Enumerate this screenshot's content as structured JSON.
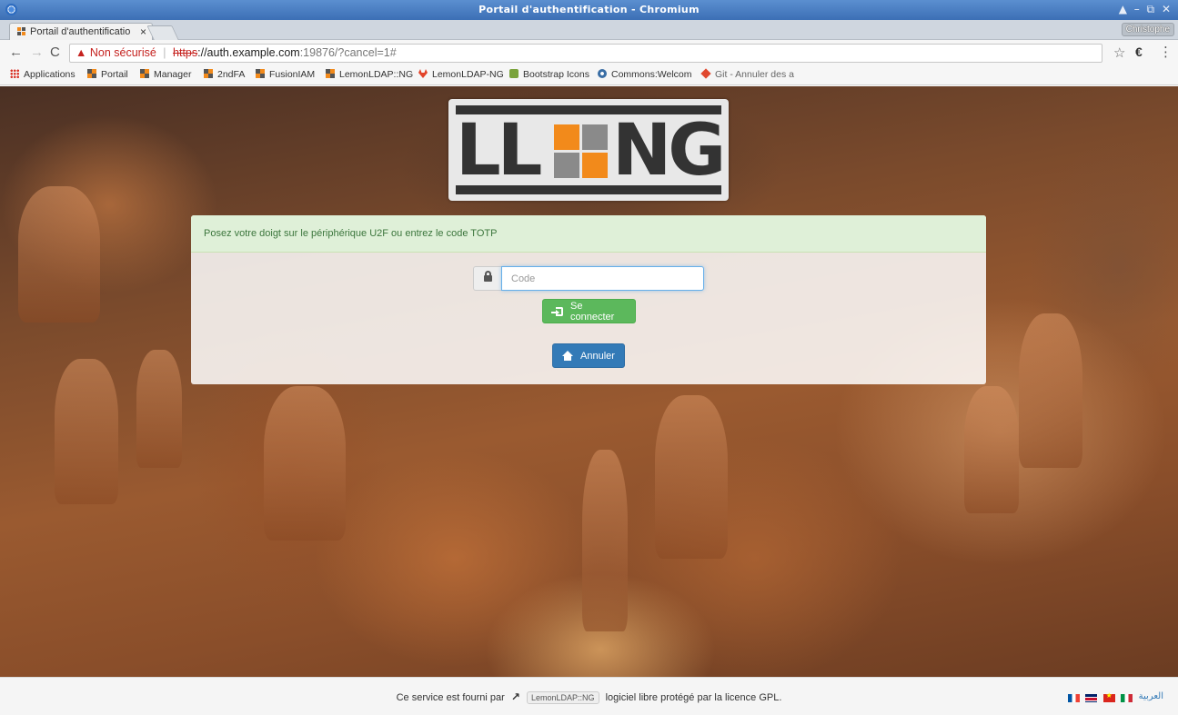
{
  "window": {
    "title": "Portail d'authentification - Chromium",
    "controls": "▲ – ⧉ ✕"
  },
  "tabs": [
    {
      "label": "Portail d'authentificatio",
      "close": "×"
    }
  ],
  "profile": {
    "name": "Christophe"
  },
  "omnibox": {
    "warning_label": "Non sécurisé",
    "scheme": "https",
    "host": "://auth.example.com",
    "rest": ":19876/?cancel=1#"
  },
  "bookmarks": [
    {
      "label": "Applications",
      "icon": "apps-grid-icon"
    },
    {
      "label": "Portail",
      "icon": "lemonldap-icon"
    },
    {
      "label": "Manager",
      "icon": "lemonldap-icon"
    },
    {
      "label": "2ndFA",
      "icon": "lemonldap-icon"
    },
    {
      "label": "FusionIAM",
      "icon": "lemonldap-icon"
    },
    {
      "label": "LemonLDAP::NG",
      "icon": "lemonldap-icon"
    },
    {
      "label": "LemonLDAP-NG",
      "icon": "gitlab-icon"
    },
    {
      "label": "Bootstrap Icons",
      "icon": "bootstrap-icon"
    },
    {
      "label": "Commons:Welcom",
      "icon": "wikimedia-icon"
    },
    {
      "label": "Git - Annuler des a",
      "icon": "git-icon"
    }
  ],
  "logo": {
    "text_left": "LL",
    "text_right": "NG",
    "colors": {
      "dark": "#333333",
      "orange": "#f28a1b",
      "light": "#e8e8e8",
      "mid": "#8a8a8a"
    }
  },
  "auth": {
    "message": "Posez votre doigt sur le périphérique U2F ou entrez le code TOTP",
    "code_placeholder": "Code",
    "login_button": "Se connecter",
    "cancel_button": "Annuler"
  },
  "footer": {
    "text_before": "Ce service est fourni par",
    "product": "LemonLDAP::NG",
    "text_after": "logiciel libre protégé par la licence GPL.",
    "languages": [
      "fr",
      "en",
      "vi",
      "it"
    ],
    "arabic_label": "العربية"
  },
  "colors": {
    "success_bg": "#dff0d8",
    "success_text": "#3c763d",
    "btn_success": "#5cb85c",
    "btn_primary": "#337ab7",
    "insecure_red": "#c5221f"
  }
}
